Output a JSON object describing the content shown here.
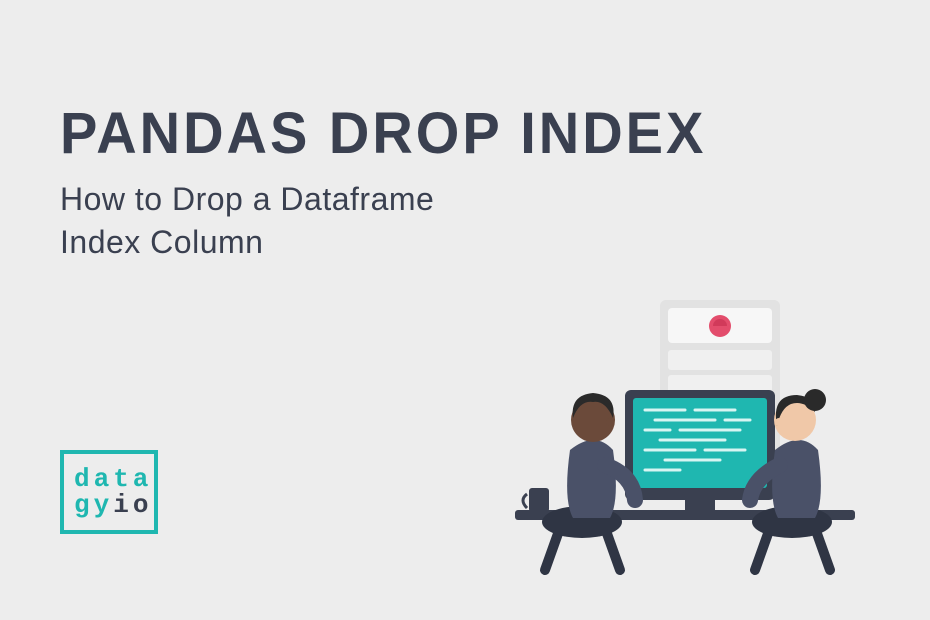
{
  "title": "PANDAS DROP INDEX",
  "subtitle_line1": "How to Drop a Dataframe",
  "subtitle_line2": "Index Column",
  "logo": {
    "line1": "data",
    "gy": "gy",
    "io": "io"
  }
}
